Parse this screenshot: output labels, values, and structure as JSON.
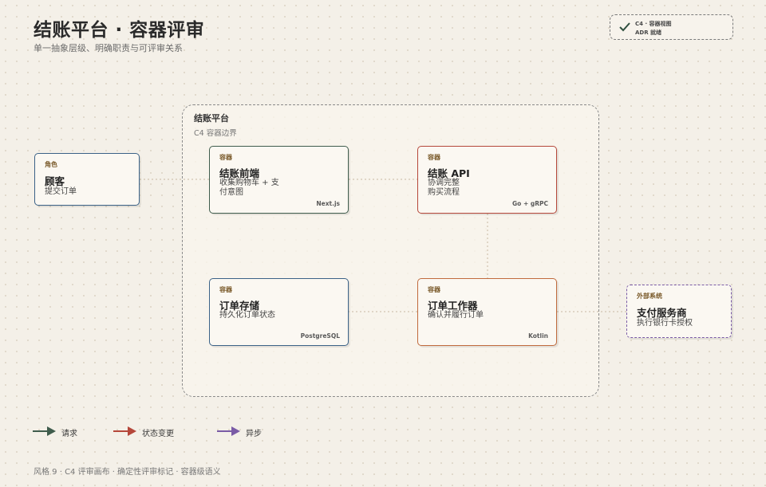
{
  "header": {
    "title": "结账平台 · 容器评审",
    "subtitle": "单一抽象层级、明确职责与可评审关系"
  },
  "stamp": {
    "line1": "C4 · 容器视图",
    "line2": "ADR 就绪",
    "icon": "check-icon"
  },
  "boundary": {
    "title": "结账平台",
    "subtitle": "C4 容器边界"
  },
  "nodes": {
    "person": {
      "kind": "角色",
      "name": "顾客",
      "desc": "提交订单",
      "color": "#3b6287"
    },
    "frontend": {
      "kind": "容器",
      "name": "结账前端",
      "desc": "收集购物车 + 支付意图",
      "tech": "Next.js",
      "color": "#3f5c4c"
    },
    "api": {
      "kind": "容器",
      "name": "结账 API",
      "desc": "协调完整购买流程",
      "tech": "Go + gRPC",
      "color": "#b5473a"
    },
    "store": {
      "kind": "容器",
      "name": "订单存储",
      "desc": "持久化订单状态",
      "tech": "PostgreSQL",
      "color": "#3b6287"
    },
    "worker": {
      "kind": "容器",
      "name": "订单工作器",
      "desc": "确认并履行订单",
      "tech": "Kotlin",
      "color": "#c06a3c"
    },
    "external": {
      "kind": "外部系统",
      "name": "支付服务商",
      "desc": "执行银行卡授权",
      "color": "#7a5ba6"
    }
  },
  "legend": {
    "request": {
      "label": "请求",
      "color": "#3f5c4c"
    },
    "state_change": {
      "label": "状态变更",
      "color": "#b5473a"
    },
    "async": {
      "label": "异步",
      "color": "#7a5ba6"
    }
  },
  "footer": "风格 9 · C4 评审画布 · 确定性评审标记 · 容器级语义"
}
